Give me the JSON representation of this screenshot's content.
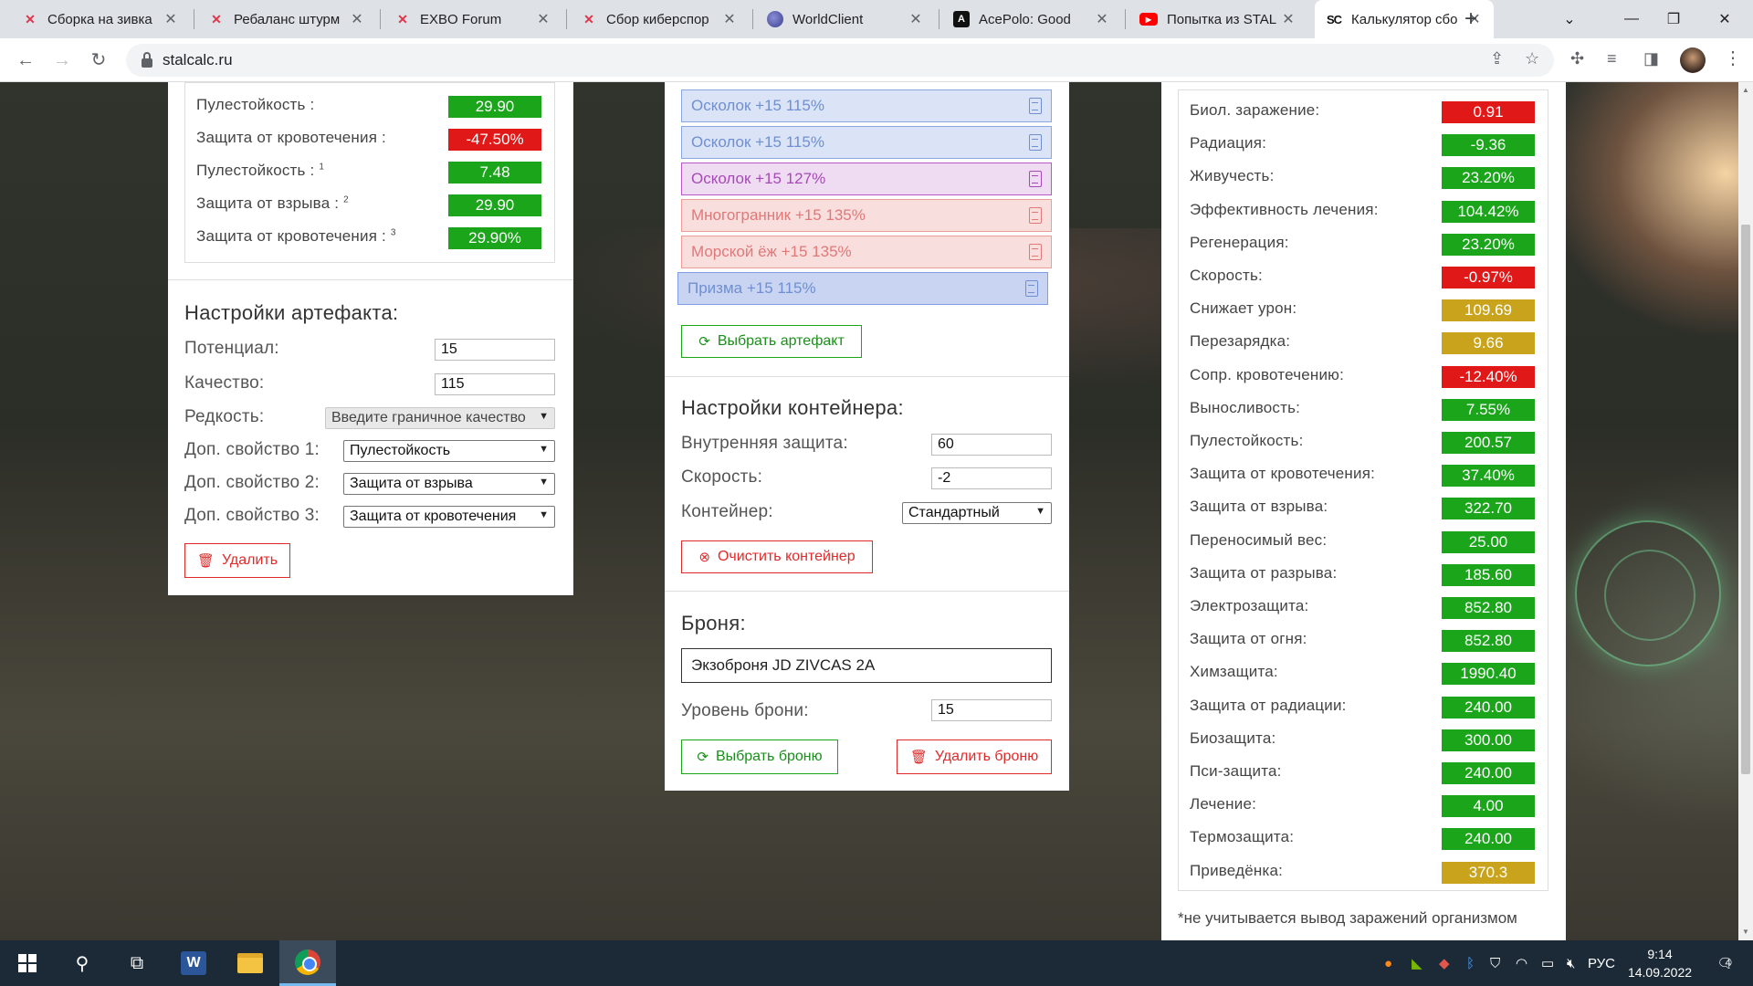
{
  "browser": {
    "tabs": [
      {
        "label": "Сборка на зивка",
        "icon": "exbo-icon"
      },
      {
        "label": "Ребаланс штурм",
        "icon": "exbo-icon"
      },
      {
        "label": "EXBO Forum",
        "icon": "exbo-icon"
      },
      {
        "label": "Сбор киберспор",
        "icon": "exbo-icon"
      },
      {
        "label": "WorldClient",
        "icon": "worldclient-icon"
      },
      {
        "label": "AcePolo: Good",
        "icon": "acepolo-icon"
      },
      {
        "label": "Попытка из STAL",
        "icon": "youtube-icon"
      },
      {
        "label": "Калькулятор сбо",
        "icon": "stalcalc-icon"
      }
    ],
    "url": "stalcalc.ru",
    "favicon_text": {
      "stalcalc": "SC",
      "acepolo": "A",
      "youtube": "▶"
    }
  },
  "left_panel": {
    "stats": [
      {
        "label": "Пулестойкость :",
        "sup": "",
        "value": "29.90",
        "color": "green"
      },
      {
        "label": "Защита от кровотечения :",
        "sup": "",
        "value": "-47.50%",
        "color": "red"
      },
      {
        "label": "Пулестойкость :",
        "sup": "1",
        "value": "7.48",
        "color": "green"
      },
      {
        "label": "Защита от взрыва :",
        "sup": "2",
        "value": "29.90",
        "color": "green"
      },
      {
        "label": "Защита от кровотечения :",
        "sup": "3",
        "value": "29.90%",
        "color": "green"
      }
    ],
    "artifact_settings": {
      "title": "Настройки артефакта:",
      "potential_label": "Потенциал:",
      "potential_value": "15",
      "quality_label": "Качество:",
      "quality_value": "115",
      "rarity_label": "Редкость:",
      "rarity_value": "Введите граничное качество",
      "extra1_label": "Доп. свойство 1:",
      "extra1_value": "Пулестойкость",
      "extra2_label": "Доп. свойство 2:",
      "extra2_value": "Защита от взрыва",
      "extra3_label": "Доп. свойство 3:",
      "extra3_value": "Защита от кровотечения",
      "delete_label": "Удалить"
    }
  },
  "middle_panel": {
    "artifacts": [
      {
        "label": "Осколок +15 115%",
        "style": "blue"
      },
      {
        "label": "Осколок +15 115%",
        "style": "blue"
      },
      {
        "label": "Осколок +15 127%",
        "style": "purple"
      },
      {
        "label": "Многогранник +15 135%",
        "style": "pink"
      },
      {
        "label": "Морской ёж +15 135%",
        "style": "pink"
      },
      {
        "label": "Призма +15 115%",
        "style": "blue2"
      }
    ],
    "choose_artifact_label": "Выбрать артефакт",
    "container": {
      "title": "Настройки контейнера:",
      "inner_protection_label": "Внутренняя защита:",
      "inner_protection_value": "60",
      "speed_label": "Скорость:",
      "speed_value": "-2",
      "container_label": "Контейнер:",
      "container_value": "Стандартный",
      "clear_label": "Очистить контейнер"
    },
    "armor": {
      "title": "Броня:",
      "name": "Экзоброня JD ZIVCAS 2A",
      "level_label": "Уровень брони:",
      "level_value": "15",
      "choose_label": "Выбрать броню",
      "delete_label": "Удалить броню"
    }
  },
  "right_panel": {
    "stats": [
      {
        "label": "Биол. заражение:",
        "value": "0.91",
        "color": "red"
      },
      {
        "label": "Радиация:",
        "value": "-9.36",
        "color": "green"
      },
      {
        "label": "Живучесть:",
        "value": "23.20%",
        "color": "green"
      },
      {
        "label": "Эффективность лечения:",
        "value": "104.42%",
        "color": "green"
      },
      {
        "label": "Регенерация:",
        "value": "23.20%",
        "color": "green"
      },
      {
        "label": "Скорость:",
        "value": "-0.97%",
        "color": "red"
      },
      {
        "label": "Снижает урон:",
        "value": "109.69",
        "color": "gold"
      },
      {
        "label": "Перезарядка:",
        "value": "9.66",
        "color": "gold"
      },
      {
        "label": "Сопр. кровотечению:",
        "value": "-12.40%",
        "color": "red"
      },
      {
        "label": "Выносливость:",
        "value": "7.55%",
        "color": "green"
      },
      {
        "label": "Пулестойкость:",
        "value": "200.57",
        "color": "green"
      },
      {
        "label": "Защита от кровотечения:",
        "value": "37.40%",
        "color": "green"
      },
      {
        "label": "Защита от взрыва:",
        "value": "322.70",
        "color": "green"
      },
      {
        "label": "Переносимый вес:",
        "value": "25.00",
        "color": "green"
      },
      {
        "label": "Защита от разрыва:",
        "value": "185.60",
        "color": "green"
      },
      {
        "label": "Электрозащита:",
        "value": "852.80",
        "color": "green"
      },
      {
        "label": "Защита от огня:",
        "value": "852.80",
        "color": "green"
      },
      {
        "label": "Химзащита:",
        "value": "1990.40",
        "color": "green"
      },
      {
        "label": "Защита от радиации:",
        "value": "240.00",
        "color": "green"
      },
      {
        "label": "Биозащита:",
        "value": "300.00",
        "color": "green"
      },
      {
        "label": "Пси-защита:",
        "value": "240.00",
        "color": "green"
      },
      {
        "label": "Лечение:",
        "value": "4.00",
        "color": "green"
      },
      {
        "label": "Термозащита:",
        "value": "240.00",
        "color": "green"
      },
      {
        "label": "Приведёнка:",
        "value": "370.3",
        "color": "gold"
      }
    ],
    "footnote": "*не учитывается вывод заражений организмом"
  },
  "colors": {
    "green": "#1aa51a",
    "red": "#e01818",
    "gold": "#c8a31b"
  },
  "taskbar": {
    "language": "РУС",
    "time": "9:14",
    "date": "14.09.2022",
    "notifications": "4",
    "word_letter": "W"
  }
}
